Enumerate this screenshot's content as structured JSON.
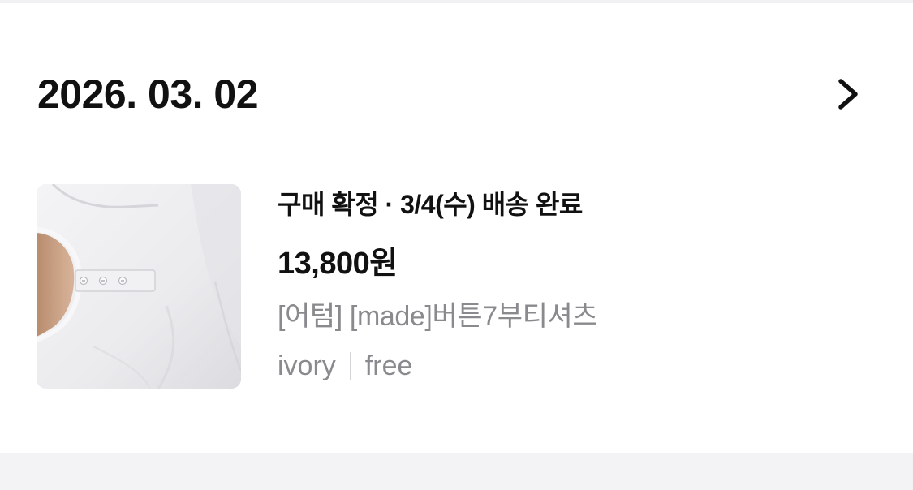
{
  "order": {
    "date": "2026. 03. 02",
    "detail_icon": "chevron-right-icon",
    "item": {
      "status": "구매 확정 · 3/4(수) 배송 완료",
      "price": "13,800원",
      "name": "[어텀] [made]버튼7부티셔츠",
      "options": [
        "ivory",
        "free"
      ],
      "thumbnail_icon": "product-photo-white-button-tee"
    }
  },
  "colors": {
    "text_primary": "#111111",
    "text_secondary": "#8a8a8e",
    "background": "#ffffff",
    "page_background": "#f3f3f5"
  }
}
